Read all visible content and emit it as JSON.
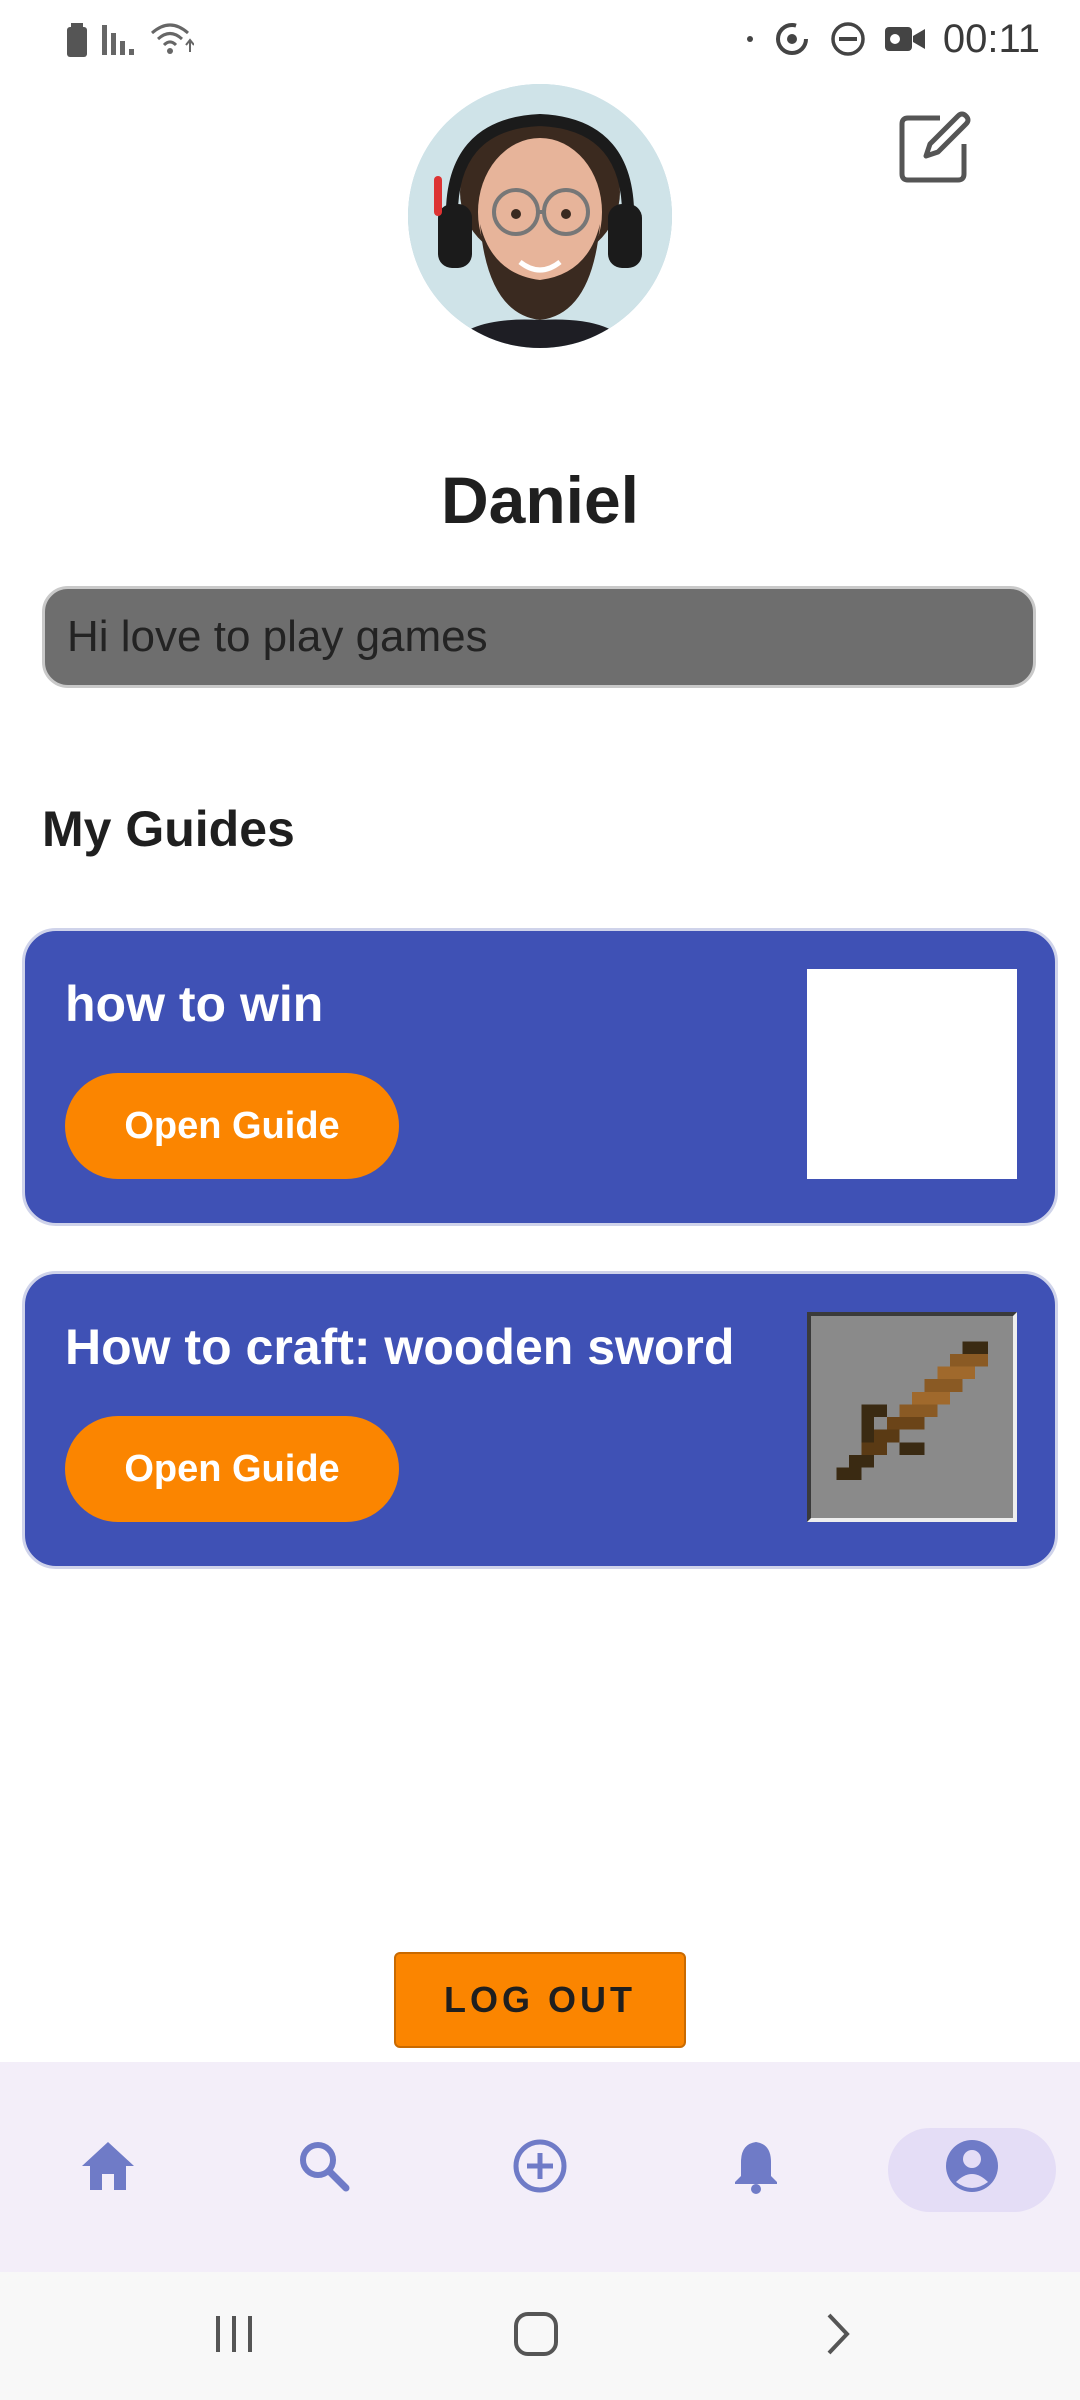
{
  "status_bar": {
    "time": "00:11",
    "left_icons": [
      "battery-icon",
      "signal-icon",
      "wifi-icon"
    ],
    "right_icons": [
      "dot-icon",
      "sync-icon",
      "do-not-disturb-icon",
      "video-camera-icon"
    ]
  },
  "profile": {
    "name": "Daniel",
    "bio": "Hi love to play games",
    "avatar_icon": "avatar-photo",
    "edit_icon": "edit-icon"
  },
  "guides": {
    "section_title": "My Guides",
    "items": [
      {
        "title": "how to win",
        "button_label": "Open Guide",
        "thumbnail": "blank-thumbnail"
      },
      {
        "title": "How to craft: wooden sword",
        "button_label": "Open Guide",
        "thumbnail": "wooden-sword-icon"
      }
    ]
  },
  "logout": {
    "label": "LOG OUT"
  },
  "bottom_nav": {
    "items": [
      "home-icon",
      "search-icon",
      "add-circle-icon",
      "bell-icon",
      "account-icon"
    ],
    "active_index": 4,
    "colors": {
      "icon": "#6f7bc7",
      "active_pill": "#e4ddf6",
      "background": "#f3eef9"
    }
  },
  "colors": {
    "card": "#3f51b5",
    "accent": "#fb8500",
    "bio_background": "#6e6e6e"
  }
}
